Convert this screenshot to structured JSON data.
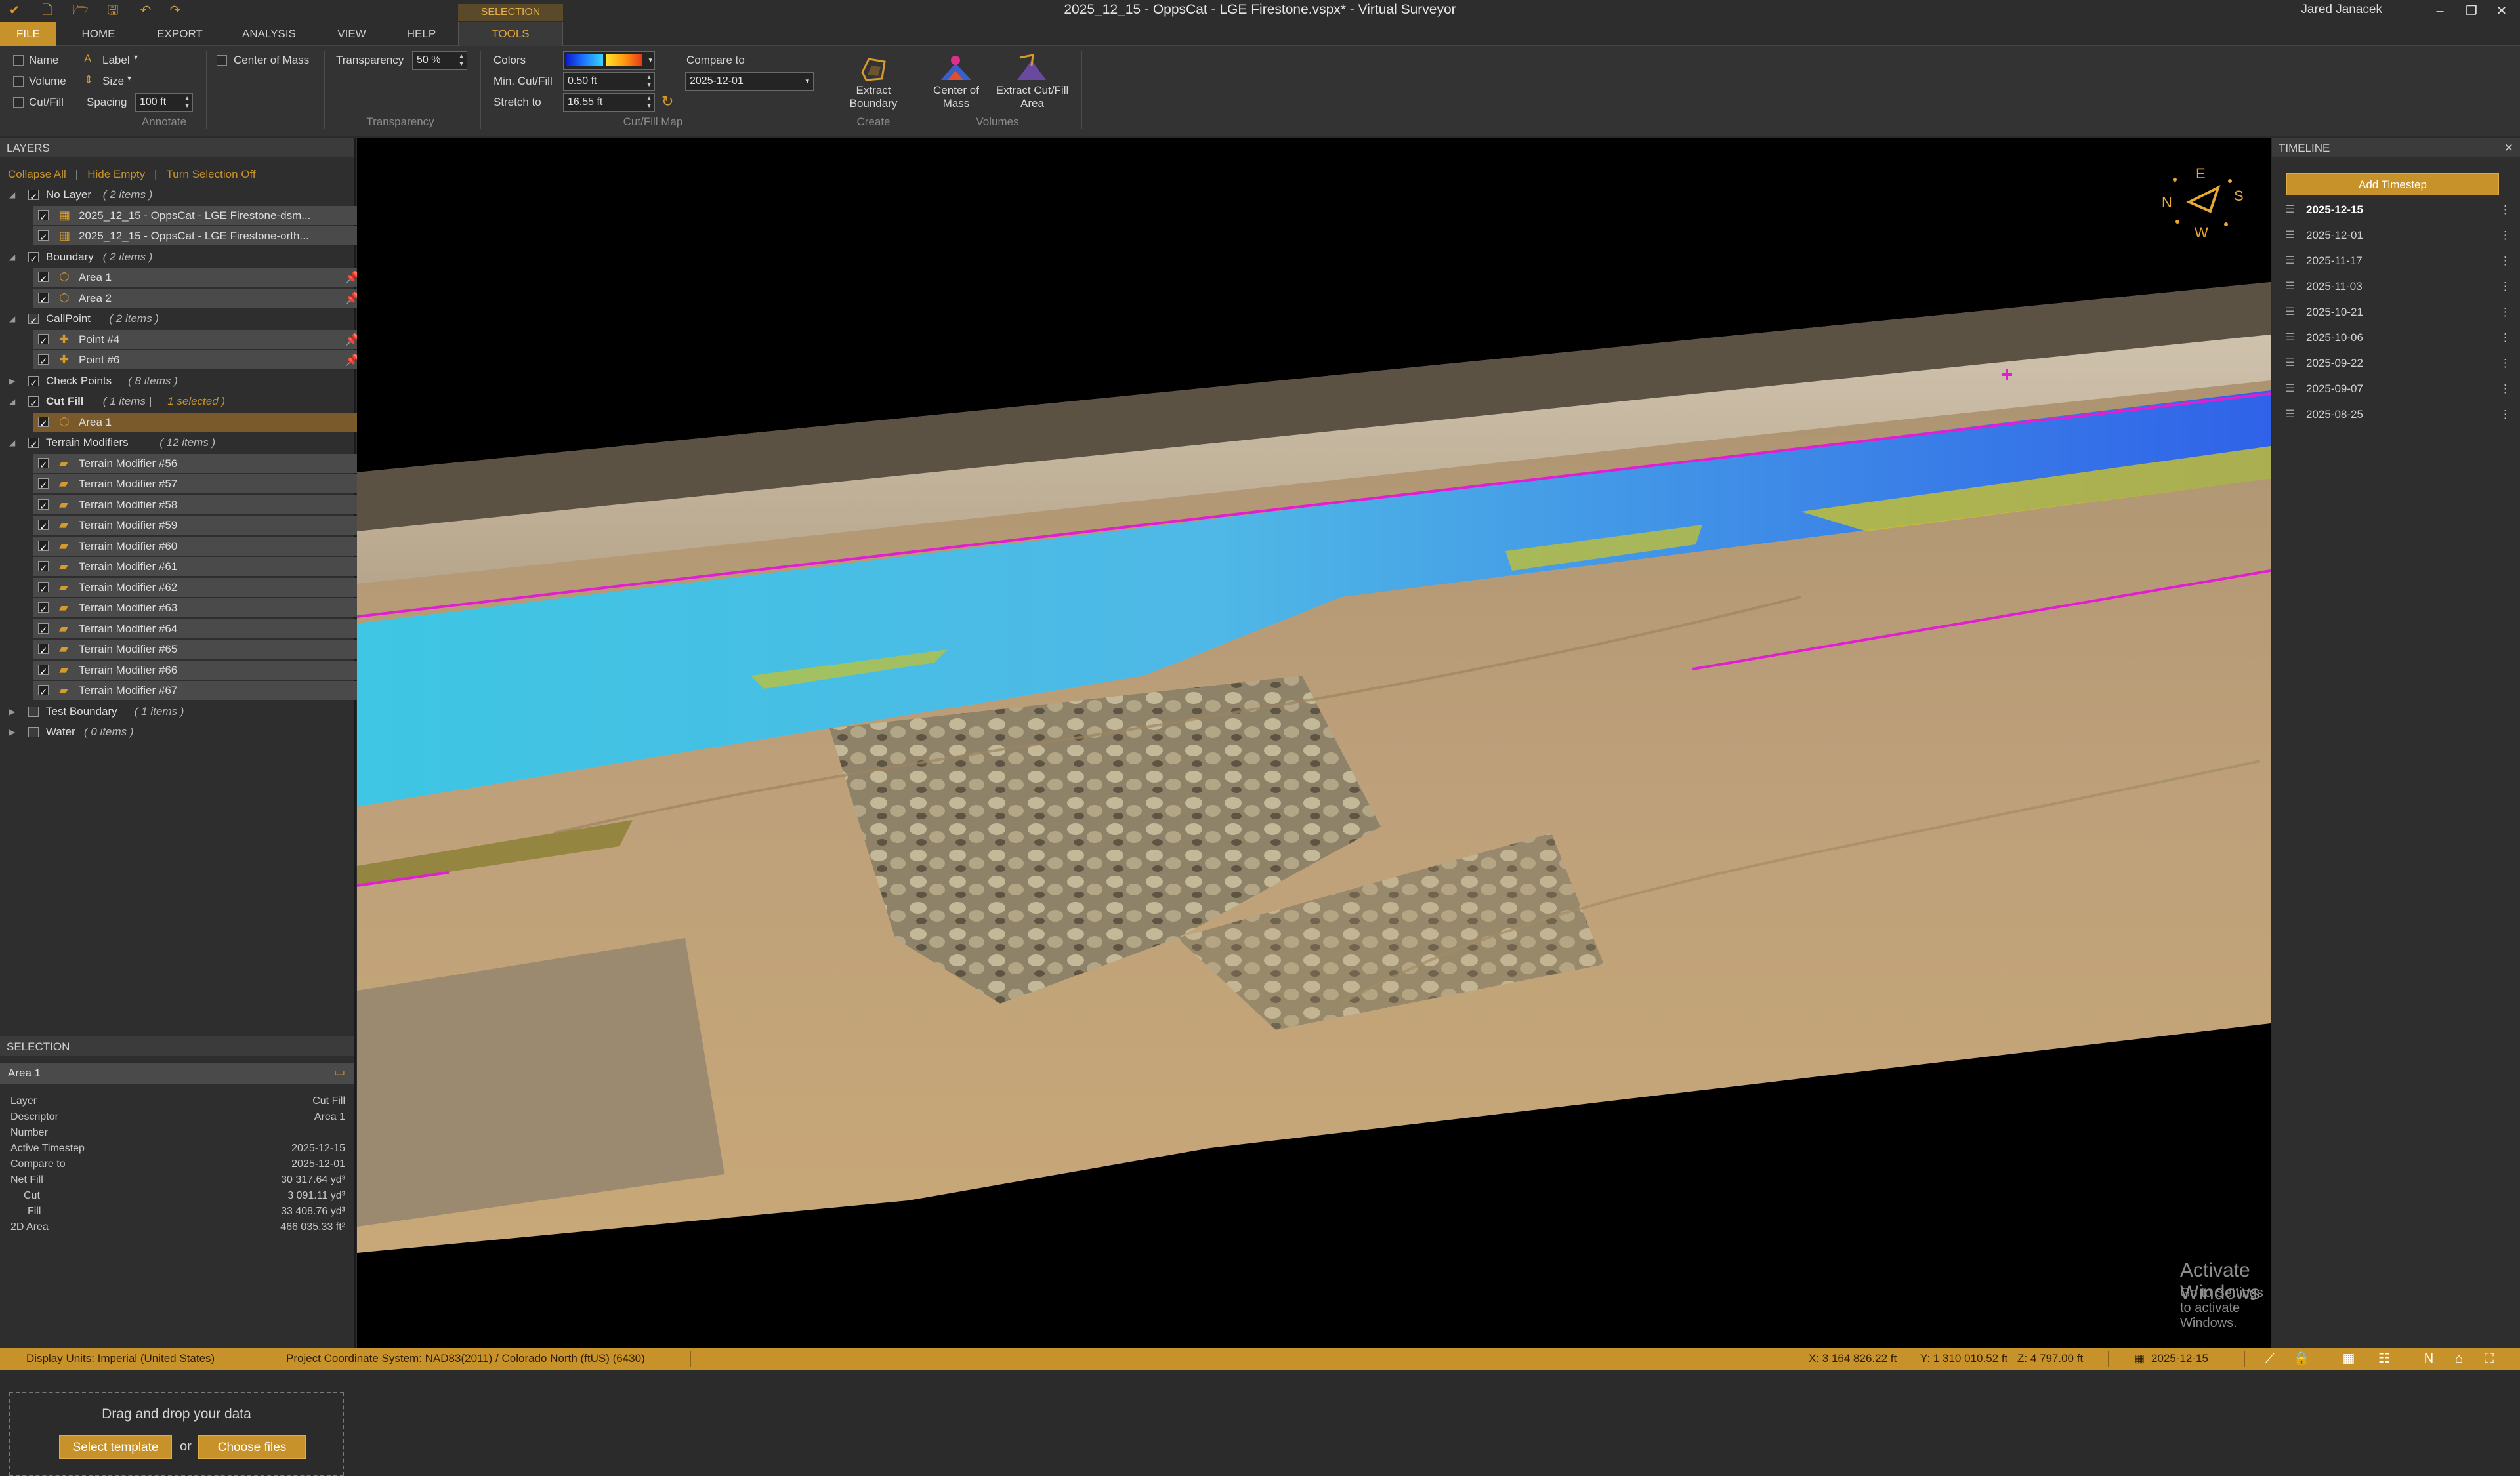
{
  "window": {
    "title": "2025_12_15 - OppsCat - LGE Firestone.vspx* - Virtual Surveyor",
    "user": "Jared Janacek",
    "minimize": "–",
    "maximize": "❐",
    "close": "✕"
  },
  "ribbon_tabs": {
    "context_group": "SELECTION",
    "file": "FILE",
    "home": "HOME",
    "export": "EXPORT",
    "analysis": "ANALYSIS",
    "view": "VIEW",
    "help": "HELP",
    "tools": "TOOLS"
  },
  "ribbon": {
    "annotate": {
      "name": "Name",
      "volume": "Volume",
      "cutfill": "Cut/Fill",
      "label": "Label",
      "size": "Size",
      "spacing": "Spacing",
      "spacing_value": "100 ft",
      "center_of_mass": "Center of Mass",
      "group": "Annotate"
    },
    "transparency": {
      "label": "Transparency",
      "value": "50 %",
      "group": "Transparency"
    },
    "cutfill_map": {
      "colors": "Colors",
      "min_label": "Min. Cut/Fill",
      "min_value": "0.50 ft",
      "stretch_label": "Stretch to",
      "stretch_value": "16.55 ft",
      "compare_label": "Compare to",
      "compare_value": "2025-12-01",
      "group": "Cut/Fill Map"
    },
    "create": {
      "extract_boundary": "Extract Boundary",
      "group": "Create"
    },
    "volumes": {
      "center_of_mass": "Center of Mass",
      "extract_cutfill": "Extract Cut/Fill Area",
      "group": "Volumes"
    }
  },
  "layers_panel": {
    "header": "LAYERS",
    "actions": {
      "collapse_all": "Collapse All",
      "hide_empty": "Hide Empty",
      "turn_off": "Turn Selection Off"
    },
    "groups": [
      {
        "name": "No Layer",
        "count": "( 2 items )",
        "children": [
          "2025_12_15 - OppsCat - LGE Firestone-dsm...",
          "2025_12_15 - OppsCat - LGE Firestone-orth..."
        ]
      },
      {
        "name": "Boundary",
        "count": "( 2 items )",
        "children": [
          "Area 1",
          "Area 2"
        ]
      },
      {
        "name": "CallPoint",
        "count": "( 2 items )",
        "children": [
          "Point #4",
          "Point #6"
        ]
      },
      {
        "name": "Check Points",
        "count": "( 8 items )",
        "children": []
      },
      {
        "name": "Cut Fill",
        "count": "( 1 items |",
        "selected": "1 selected )",
        "children": [
          "Area 1"
        ]
      },
      {
        "name": "Terrain Modifiers",
        "count": "( 12 items )",
        "children": [
          "Terrain Modifier #56",
          "Terrain Modifier #57",
          "Terrain Modifier #58",
          "Terrain Modifier #59",
          "Terrain Modifier #60",
          "Terrain Modifier #61",
          "Terrain Modifier #62",
          "Terrain Modifier #63",
          "Terrain Modifier #64",
          "Terrain Modifier #65",
          "Terrain Modifier #66",
          "Terrain Modifier #67"
        ]
      },
      {
        "name": "Test Boundary",
        "count": "( 1 items )",
        "children": []
      },
      {
        "name": "Water",
        "count": "( 0 items )",
        "children": []
      }
    ]
  },
  "selection_panel": {
    "header": "SELECTION",
    "title": "Area 1",
    "properties": [
      {
        "k": "Layer",
        "v": "Cut Fill"
      },
      {
        "k": "Descriptor",
        "v": "Area 1"
      },
      {
        "k": "Number",
        "v": ""
      },
      {
        "k": "Active Timestep",
        "v": "2025-12-15"
      },
      {
        "k": "Compare to",
        "v": "2025-12-01"
      },
      {
        "k": "Net Fill",
        "v": "30 317.64 yd³"
      },
      {
        "k": "Cut",
        "v": "3 091.11 yd³"
      },
      {
        "k": "Fill",
        "v": "33 408.76 yd³"
      },
      {
        "k": "2D Area",
        "v": "466 035.33 ft²"
      }
    ]
  },
  "dropzone": {
    "text": "Drag and drop your data",
    "select_template": "Select template",
    "or": "or",
    "choose_files": "Choose files"
  },
  "compass": {
    "n": "N",
    "e": "E",
    "s": "S",
    "w": "W"
  },
  "timeline": {
    "header": "TIMELINE",
    "add": "Add Timestep",
    "items": [
      "2025-12-15",
      "2025-12-01",
      "2025-11-17",
      "2025-11-03",
      "2025-10-21",
      "2025-10-06",
      "2025-09-22",
      "2025-09-07",
      "2025-08-25"
    ],
    "active": "2025-12-15"
  },
  "watermark": {
    "line1": "Activate Windows",
    "line2": "Go to Settings to activate Windows."
  },
  "status": {
    "display_units": "Display Units:  Imperial (United States)",
    "crs": "Project Coordinate System:  NAD83(2011) / Colorado North (ftUS) (6430)",
    "x": "X: 3 164 826.22 ft",
    "y": "Y: 1 310 010.52 ft",
    "z": "Z: 4 797.00 ft",
    "date": "2025-12-15"
  },
  "colors": {
    "accent": "#c8922a",
    "cut_fill_line": "#e11ed2",
    "cut_blue": "#2f7fe8",
    "fill_yellow": "#d8cf2a"
  }
}
